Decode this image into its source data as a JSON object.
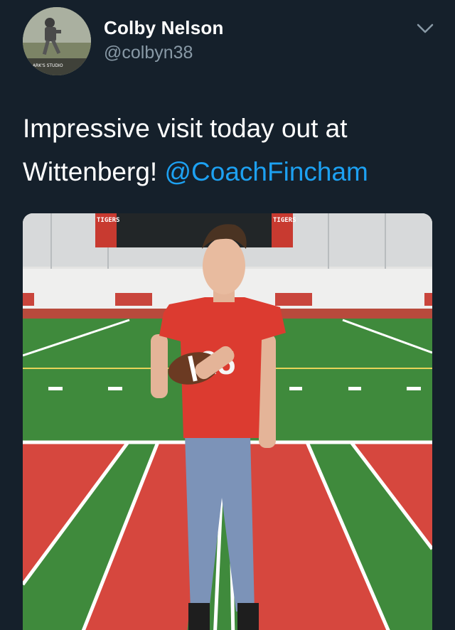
{
  "user": {
    "display_name": "Colby Nelson",
    "handle": "@colbyn38"
  },
  "avatar_text": "ARK'S STUDIO",
  "tweet": {
    "text_line1": "Impressive visit today out at",
    "text_line2_prefix": "Wittenberg! ",
    "mention": "@CoachFincham"
  },
  "photo": {
    "banner_left": "TIGERS",
    "banner_right": "TIGERS",
    "jersey_number": "25"
  },
  "colors": {
    "background": "#15202b",
    "mention": "#1da1f2",
    "handle": "#8899a6",
    "turf_green": "#3f8a3c",
    "endzone_red": "#d6473e"
  }
}
